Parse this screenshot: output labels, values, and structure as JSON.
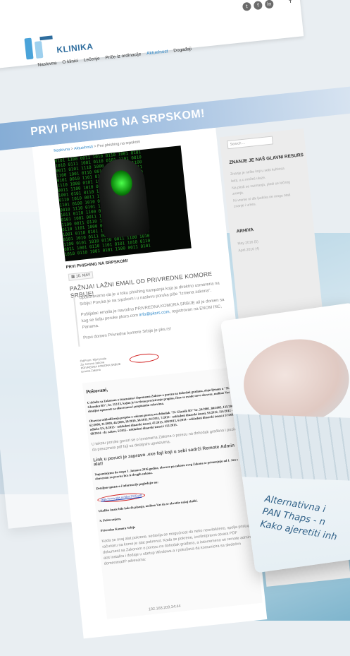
{
  "header": {
    "social_icons": [
      "twitter-icon",
      "facebook-icon",
      "linkedin-icon"
    ],
    "search_icon": "search-icon",
    "logo": {
      "text": "KLINIKA",
      "colors": {
        "primary": "#2e6d9e",
        "light": "#9ed0ee",
        "accent": "#4aa3d9"
      }
    },
    "nav": [
      "Naslovna",
      "O klinici",
      "Lečenje",
      "Priče iz ordinacije",
      "Aktuelnost",
      "Događaji"
    ],
    "active_nav": "Aktuelnost"
  },
  "hero": {
    "title": "PRVI PHISHING NA SRPSKOM!"
  },
  "breadcrumb": {
    "home": "Naslovna",
    "sep": ">",
    "section": "Aktuelnosti",
    "current": "Prvi phishing na srpskom"
  },
  "article": {
    "small_title": "PRVI PHISHING NA SRPSKOM!",
    "date": "10. MAY",
    "subtitle": "PAŽNJA! LAŽNI EMAIL OD PRIVREDNE KOMORE SRBIJE!",
    "quote": [
      "Upozoravamo da je u toku phishing kampanja koja je direktno usmerena na Srbiju! Poruka je na srpskom i u naslovu poruka piše \"Izmena zakona\".",
      "Pošiljalac emaila je navodno PRIVREDNA KOMORA SRBIJE ali je domen sa kog se šalju poruke pksrs.com",
      "info@pksrs.com",
      ", registrovan na ENOM INC, Panama.",
      "Pravi domen Privredne komore Srbije je pks.rs!"
    ],
    "email_thumb": [
      "Od/From: Ključ posla",
      "Za: Izmena zakona",
      "PRIVREDNA KOMORA SRBIJE",
      "Izmena Zakona"
    ],
    "doc": {
      "greeting": "Poštovani,",
      "p1": "U skladu sa Zakonom o izmenama i dopunama Zakona o porezu na dohodak građana, objavljenom u \"Sl. Glasniku RS\", br. 112/15, kojim je izvršeno preciziranje propisa, čime se uvode nove obaveze, molimo Vas da se detaljno upoznate sa obavezama i propisanim rokovima.",
      "p2": "Obaveza uskladištenja propisa o zakonu porezu na dohodak \"Sl. Glasnik RS\" br. 24/2001, 80/2002, 135/2004, 62/2006, 31/2009, 44/2009, 18/2010, 50/2011, 91/2011, 7/2012 - usklađeni dinarski iznosi, 93/2012, 114/2012 - odluka US, 8/2013 - usklađeni dinarski iznosi, 47/2013, 108/2013, 6/2014 - usklađeni dinarski iznosi i 57/2014, 68/2014 - dr. zakon, 5/2015 - usklađeni dinarski iznosi i 112/2015.",
      "grey1": "U tekstu poruke govori se o Izmenama Zakona o porezu na dohodak građana i poziva da preuzmete pdf fajl sa detaljnim uputstvima.",
      "link_note": "Link u poruci je zapravo .exe fajl koji u sebi sadrži Remote Admin alat!",
      "p3": "Napominjemo da stupa 1. Januara 2016 godine, obaveze po zakonu uveg Zakona se primenjuju od 1. Jan s obavezom za pravna lica iz drugih zakona.",
      "p4": "Detaljno uputstvo i informacije pogledajte na:",
      "link": "http://www.pks.rs/files/2016.pdf",
      "p5": "Ukoliko imate bilo kakvih pitanja, molimo Vas da se obratite našoj službi.",
      "sign1": "S. Poštovanjem,",
      "sign2": "Privredna Komora Srbije",
      "grey2": "Kada se ovaj alat pokrene, sedavija se mogućnost da neko neovlašćeno, spolja pristupi računaru na kome je alat pokrenut. Kada se pokrene, izvršni/pravni otvara PDF dokument sa Zakonom o porezu na dohodak građana, a istovremeno se remote admin alat instalira i dodaje u startup Windows-a i pokušava da komunicira sa sledećim domenima/IP adresama:",
      "footer": "192.168.209.34:44"
    }
  },
  "sidebar": {
    "search_placeholder": "Search ...",
    "widget_title": "ZNANJE JE NAŠ GLAVNI RESURS",
    "widget_text": [
      "Znanje je nešto koji u sebi kultivisa",
      "lekti, a u možeš ulaze.",
      "Na plodi se razmanja, plodi se lečnog znanja.",
      "Ni vreme ni dik ljudska ne mogu otati znanje i umes."
    ],
    "archive_title": "ARHIVA",
    "archive": [
      "May 2016 (5)",
      "April 2016 (4)"
    ]
  },
  "background_card": {
    "lines": [
      "Alternativna i",
      "PAN Thaps - n",
      "Kako ajeretiti inh"
    ]
  }
}
